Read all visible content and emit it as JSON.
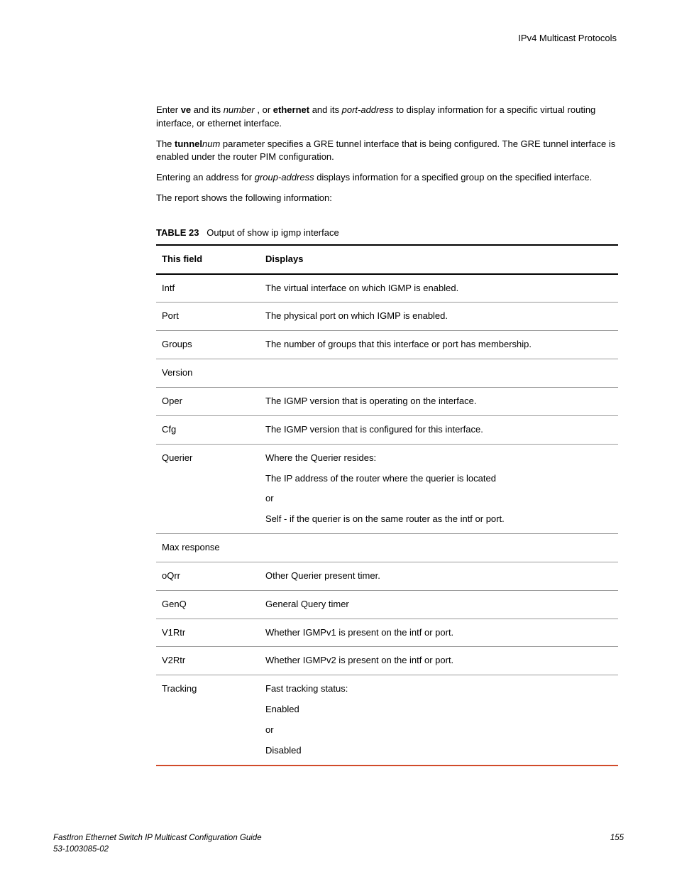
{
  "header": {
    "title": "IPv4 Multicast Protocols"
  },
  "paragraphs": {
    "p1_a": "Enter ",
    "p1_ve": "ve",
    "p1_b": " and its ",
    "p1_number": "number",
    "p1_c": " , or ",
    "p1_ethernet": "ethernet",
    "p1_d": " and its ",
    "p1_port": "port-address",
    "p1_e": " to display information for a specific virtual routing interface, or ethernet interface.",
    "p2_a": "The ",
    "p2_tunnel": "tunnel",
    "p2_num": "num",
    "p2_b": " parameter specifies a GRE tunnel interface that is being configured. The GRE tunnel interface is enabled under the router PIM configuration.",
    "p3_a": "Entering an address for ",
    "p3_group": "group-address",
    "p3_b": " displays information for a specified group on the specified interface.",
    "p4": "The report shows the following information:"
  },
  "table": {
    "caption_label": "TABLE 23",
    "caption_text": "Output of show ip igmp interface",
    "headers": {
      "c1": "This field",
      "c2": "Displays"
    },
    "rows": [
      {
        "field": "Intf",
        "desc": [
          "The virtual interface on which IGMP is enabled."
        ]
      },
      {
        "field": "Port",
        "desc": [
          "The physical port on which IGMP is enabled."
        ]
      },
      {
        "field": "Groups",
        "desc": [
          "The number of groups that this interface or port has membership."
        ]
      },
      {
        "field": "Version",
        "desc": [
          ""
        ]
      },
      {
        "field": "Oper",
        "desc": [
          "The IGMP version that is operating on the interface."
        ]
      },
      {
        "field": "Cfg",
        "desc": [
          "The IGMP version that is configured for this interface."
        ]
      },
      {
        "field": "Querier",
        "desc": [
          "Where the Querier resides:",
          "The IP address of the router where the querier is located",
          "or",
          "Self - if the querier is on the same router as the intf or port."
        ]
      },
      {
        "field": "Max response",
        "desc": [
          ""
        ]
      },
      {
        "field": "oQrr",
        "desc": [
          "Other Querier present timer."
        ]
      },
      {
        "field": "GenQ",
        "desc": [
          "General Query timer"
        ]
      },
      {
        "field": "V1Rtr",
        "desc": [
          "Whether IGMPv1 is present on the intf or port."
        ]
      },
      {
        "field": "V2Rtr",
        "desc": [
          "Whether IGMPv2 is present on the intf or port."
        ]
      },
      {
        "field": "Tracking",
        "desc": [
          "Fast tracking status:",
          "Enabled",
          "or",
          "Disabled"
        ]
      }
    ]
  },
  "footer": {
    "line1": "FastIron Ethernet Switch IP Multicast Configuration Guide",
    "line2": "53-1003085-02",
    "page": "155"
  }
}
